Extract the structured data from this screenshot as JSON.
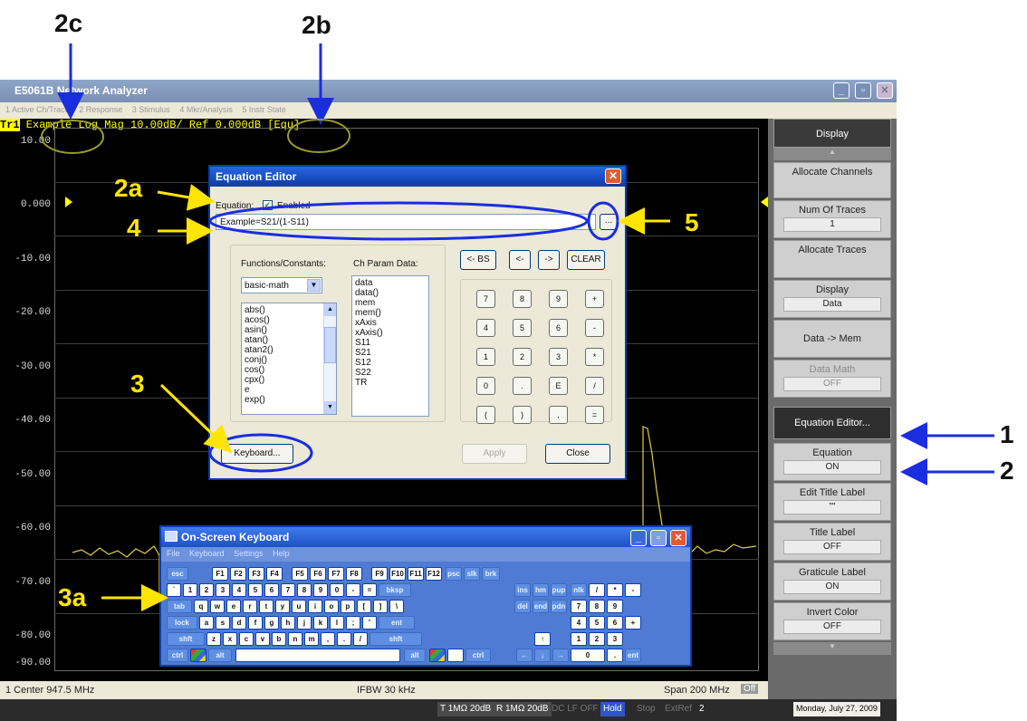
{
  "callouts": {
    "c2c": "2c",
    "c2b": "2b",
    "c2a": "2a",
    "c4": "4",
    "c5": "5",
    "c3": "3",
    "c3a": "3a",
    "c1": "1",
    "c2": "2"
  },
  "window": {
    "title": "E5061B Network Analyzer",
    "menu": [
      "1 Active Ch/Trace",
      "2 Response",
      "3 Stimulus",
      "4 Mkr/Analysis",
      "5 Instr State"
    ]
  },
  "trace_header": {
    "id": "Tr1",
    "text": " Example Log Mag 10.00dB/ Ref 0.000dB [Equ]"
  },
  "plot": {
    "yticks": [
      "10.00",
      "0.000",
      "-10.00",
      "-20.00",
      "-30.00",
      "-40.00",
      "-50.00",
      "-60.00",
      "-70.00",
      "-80.00",
      "-90.00"
    ]
  },
  "statusbar": {
    "center": "1  Center 947.5 MHz",
    "ifbw": "IFBW 30 kHz",
    "span": "Span 200 MHz",
    "span_badge": "Off"
  },
  "bottombar": {
    "items": [
      "T 1MΩ 20dB",
      "R 1MΩ 20dB",
      "DC LF OFF",
      "Hold",
      "Stop",
      "ExtRef",
      "2"
    ],
    "date": "Monday, July 27, 2009"
  },
  "softkeys": {
    "header": "Display",
    "allocate_channels": "Allocate Channels",
    "num_traces_label": "Num Of Traces",
    "num_traces_value": "1",
    "allocate_traces": "Allocate Traces",
    "display_label": "Display",
    "display_value": "Data",
    "data_mem": "Data -> Mem",
    "data_math_label": "Data Math",
    "data_math_value": "OFF",
    "equation_editor": "Equation Editor...",
    "equation_label": "Equation",
    "equation_value": "ON",
    "edit_title_label": "Edit Title Label",
    "edit_title_value": "\"\"",
    "title_label": "Title Label",
    "title_value": "OFF",
    "graticule_label": "Graticule Label",
    "graticule_value": "ON",
    "invert_color": "Invert Color",
    "invert_value": "OFF"
  },
  "equation_editor": {
    "title": "Equation Editor",
    "equation_label": "Equation:",
    "enabled_label": "Enabled",
    "enabled": true,
    "equation_value": "Example=S21/(1-S11)",
    "browse_label": "...",
    "functions_label": "Functions/Constants:",
    "functions_select": "basic-math",
    "functions_list": [
      "abs()",
      "acos()",
      "asin()",
      "atan()",
      "atan2()",
      "conj()",
      "cos()",
      "cpx()",
      "e",
      "exp()"
    ],
    "chparam_label": "Ch Param Data:",
    "chparam_list": [
      "data",
      "data()",
      "mem",
      "mem()",
      "xAxis",
      "xAxis()",
      "S11",
      "S21",
      "S12",
      "S22",
      "TR"
    ],
    "edit_buttons": [
      "<- BS",
      "<-",
      "->",
      "CLEAR"
    ],
    "keypad": [
      "7",
      "8",
      "9",
      "+",
      "4",
      "5",
      "6",
      "-",
      "1",
      "2",
      "3",
      "*",
      "0",
      ".",
      "E",
      "/",
      "(",
      ")",
      ",",
      "="
    ],
    "keyboard_button": "Keyboard...",
    "apply_button": "Apply",
    "close_button": "Close"
  },
  "osk": {
    "title": "On-Screen Keyboard",
    "menu": [
      "File",
      "Keyboard",
      "Settings",
      "Help"
    ],
    "row1": [
      "esc",
      "F1",
      "F2",
      "F3",
      "F4",
      "F5",
      "F6",
      "F7",
      "F8",
      "F9",
      "F10",
      "F11",
      "F12",
      "psc",
      "slk",
      "brk"
    ],
    "row2": [
      "`",
      "1",
      "2",
      "3",
      "4",
      "5",
      "6",
      "7",
      "8",
      "9",
      "0",
      "-",
      "=",
      "bksp",
      "ins",
      "hm",
      "pup",
      "nlk",
      "/",
      "*",
      "-"
    ],
    "row3": [
      "tab",
      "q",
      "w",
      "e",
      "r",
      "t",
      "y",
      "u",
      "i",
      "o",
      "p",
      "[",
      "]",
      "\\",
      "del",
      "end",
      "pdn",
      "7",
      "8",
      "9"
    ],
    "row4": [
      "lock",
      "a",
      "s",
      "d",
      "f",
      "g",
      "h",
      "j",
      "k",
      "l",
      ";",
      "'",
      "ent",
      "4",
      "5",
      "6",
      "+"
    ],
    "row5": [
      "shft",
      "z",
      "x",
      "c",
      "v",
      "b",
      "n",
      "m",
      ",",
      ".",
      "/",
      "shft",
      "↑",
      "1",
      "2",
      "3"
    ],
    "row6": [
      "ctrl",
      "alt",
      "alt",
      "ctrl",
      "←",
      "↓",
      "→",
      "0",
      ".",
      "ent"
    ]
  }
}
